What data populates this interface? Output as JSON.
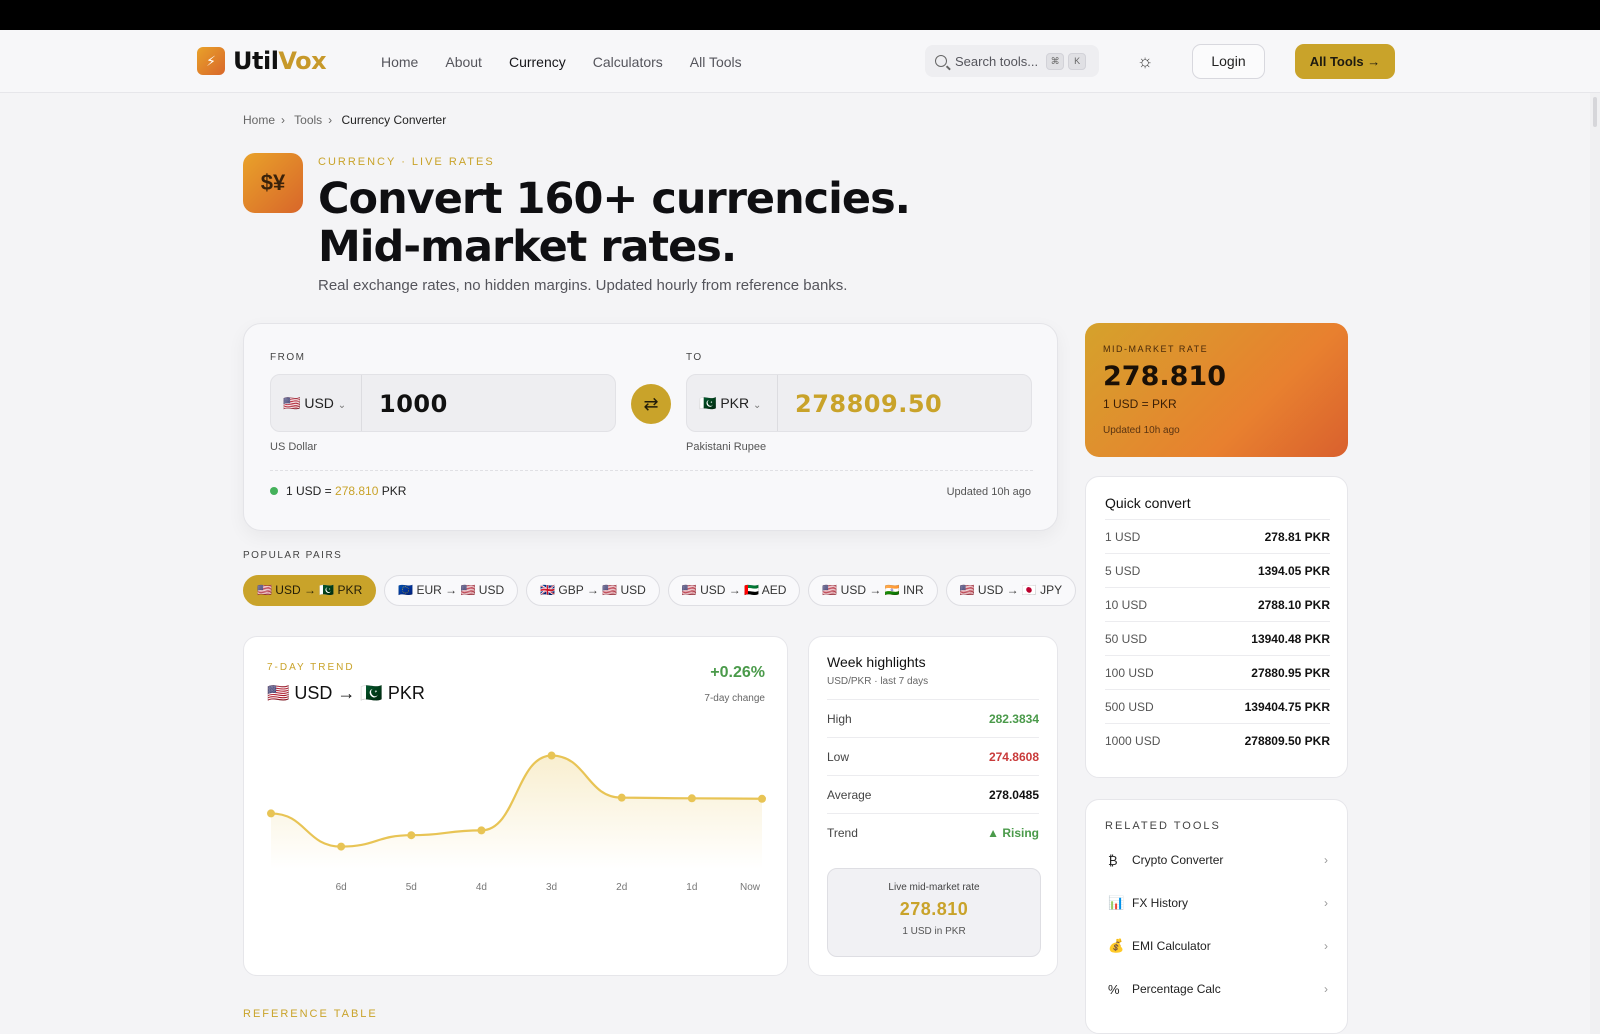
{
  "nav": {
    "brand_a": "Util",
    "brand_b": "Vox",
    "links": [
      "Home",
      "About",
      "Currency",
      "Calculators",
      "All Tools"
    ],
    "search_placeholder": "Search tools...",
    "kbd1": "⌘",
    "kbd2": "K",
    "login": "Login",
    "all_tools": "All Tools"
  },
  "breadcrumb": [
    "Home",
    "Tools",
    "Currency Converter"
  ],
  "hero": {
    "eyebrow": "CURRENCY · LIVE RATES",
    "title_line1": "Convert 160+ currencies.",
    "title_line2": "Mid-market rates.",
    "subtitle": "Real exchange rates, no hidden margins. Updated hourly from reference banks."
  },
  "converter": {
    "from_label": "FROM",
    "to_label": "TO",
    "from_currency": "USD",
    "from_amount": "1000",
    "from_name": "US Dollar",
    "to_currency": "PKR",
    "to_amount": "278809.50",
    "to_name": "Pakistani Rupee",
    "rate_prefix": "1 USD =",
    "rate_value": "278.810",
    "rate_suffix": "PKR",
    "updated": "Updated 10h ago"
  },
  "popular": {
    "label": "POPULAR PAIRS",
    "pairs": [
      "🇺🇸 USD → 🇵🇰 PKR",
      "🇪🇺 EUR → 🇺🇸 USD",
      "🇬🇧 GBP → 🇺🇸 USD",
      "🇺🇸 USD → 🇦🇪 AED",
      "🇺🇸 USD → 🇮🇳 INR",
      "🇺🇸 USD → 🇯🇵 JPY"
    ]
  },
  "trend": {
    "eyebrow": "7-DAY TREND",
    "pair": "🇺🇸 USD → 🇵🇰 PKR",
    "change": "+0.26%",
    "change_label": "7-day change"
  },
  "chart_data": {
    "type": "line",
    "x": [
      "",
      "6d",
      "5d",
      "4d",
      "3d",
      "2d",
      "1d",
      "Now"
    ],
    "values": [
      277.6,
      274.86,
      275.8,
      276.2,
      282.38,
      278.9,
      278.85,
      278.81
    ],
    "ylim": [
      274.0,
      283.5
    ],
    "color": "#e8c455",
    "grid": false
  },
  "week": {
    "title": "Week highlights",
    "subtitle": "USD/PKR · last 7 days",
    "rows": [
      {
        "label": "High",
        "value": "282.3834",
        "color": "#4a9a4a"
      },
      {
        "label": "Low",
        "value": "274.8608",
        "color": "#c93a3a"
      },
      {
        "label": "Average",
        "value": "278.0485",
        "color": "#111111"
      },
      {
        "label": "Trend",
        "value": "▲ Rising",
        "color": "#4a9a4a"
      }
    ],
    "live_label": "Live mid-market rate",
    "live_value": "278.810",
    "live_unit": "1 USD in PKR"
  },
  "rate_card": {
    "label": "MID-MARKET RATE",
    "value": "278.810",
    "unit": "1 USD = PKR",
    "updated": "Updated 10h ago"
  },
  "quick": {
    "title": "Quick convert",
    "rows": [
      {
        "a": "1 USD",
        "b": "278.81 PKR"
      },
      {
        "a": "5 USD",
        "b": "1394.05 PKR"
      },
      {
        "a": "10 USD",
        "b": "2788.10 PKR"
      },
      {
        "a": "50 USD",
        "b": "13940.48 PKR"
      },
      {
        "a": "100 USD",
        "b": "27880.95 PKR"
      },
      {
        "a": "500 USD",
        "b": "139404.75 PKR"
      },
      {
        "a": "1000 USD",
        "b": "278809.50 PKR"
      }
    ]
  },
  "related": {
    "title": "RELATED TOOLS",
    "items": [
      {
        "icon": "₿",
        "name": "Crypto Converter"
      },
      {
        "icon": "📊",
        "name": "FX History"
      },
      {
        "icon": "💰",
        "name": "EMI Calculator"
      },
      {
        "icon": "%",
        "name": "Percentage Calc"
      }
    ]
  },
  "reference": {
    "label": "REFERENCE TABLE"
  }
}
